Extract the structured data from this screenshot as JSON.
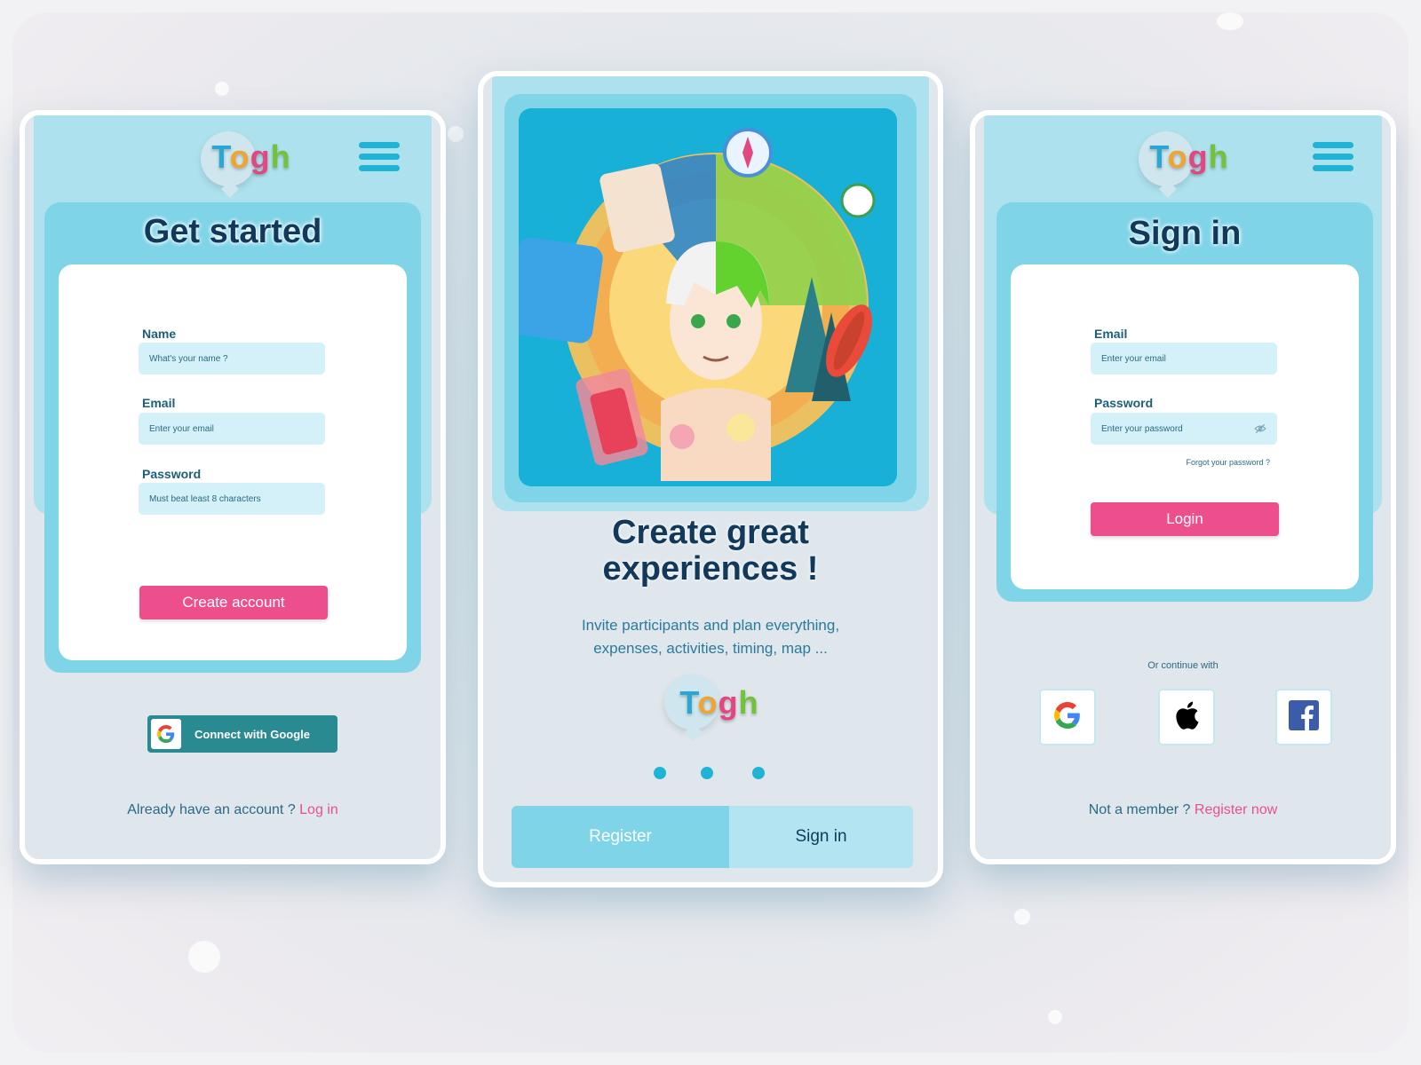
{
  "brand": {
    "name_t": "T",
    "name_o": "o",
    "name_g": "g",
    "name_h": "h"
  },
  "left_screen": {
    "title": "Get started",
    "fields": [
      {
        "label": "Name",
        "placeholder": "What's your name ?"
      },
      {
        "label": "Email",
        "placeholder": "Enter your email"
      },
      {
        "label": "Password",
        "placeholder": "Must beat least 8 characters"
      }
    ],
    "create_button": "Create account",
    "google_button": "Connect with Google",
    "footer_text": "Already have an account ? ",
    "footer_link": "Log in"
  },
  "center_screen": {
    "headline_line1": "Create great",
    "headline_line2": "experiences !",
    "subtitle_line1": "Invite participants and plan everything,",
    "subtitle_line2": "expenses, activities, timing, map ...",
    "register_tab": "Register",
    "signin_tab": "Sign in",
    "page_count": 3
  },
  "right_screen": {
    "title": "Sign in",
    "email_label": "Email",
    "email_placeholder": "Enter your email",
    "password_label": "Password",
    "password_placeholder": "Enter your password",
    "forgot_link": "Forgot your password ?",
    "login_button": "Login",
    "continue_with": "Or continue with",
    "social_icons": [
      "google-icon",
      "apple-icon",
      "facebook-icon"
    ],
    "footer_text": "Not a member ? ",
    "footer_link": "Register now"
  },
  "colors": {
    "primary_pink": "#ec4f8c",
    "cyan": "#1fb4d6",
    "panel_blue": "#7fd4e8",
    "dark_navy": "#12385a",
    "teal_button": "#2a8a92"
  }
}
